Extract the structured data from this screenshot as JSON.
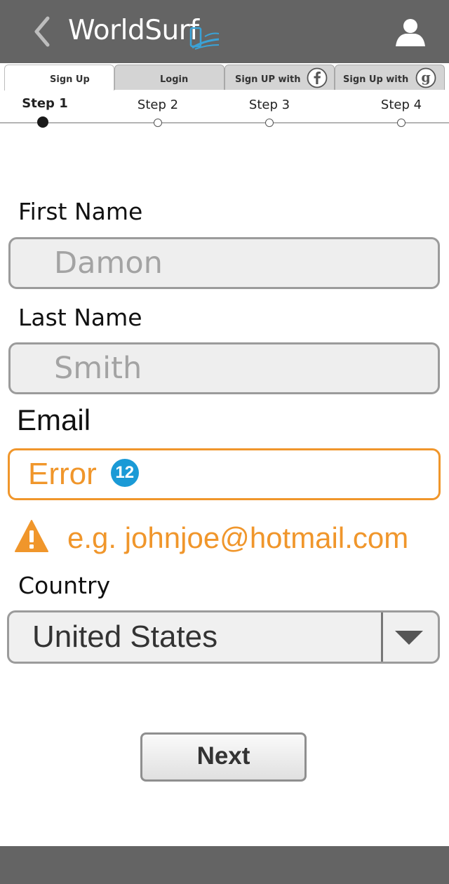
{
  "header": {
    "title": "WorldSurf",
    "back_icon": "chevron-left-icon",
    "logo_icon": "phone-wave-logo-icon",
    "user_icon": "user-icon",
    "background": "#646464"
  },
  "tabs": [
    {
      "label": "Sign Up",
      "active": true
    },
    {
      "label": "Login",
      "active": false
    },
    {
      "label": "Sign UP with",
      "icon": "facebook-icon",
      "active": false
    },
    {
      "label": "Sign Up with",
      "icon": "google-icon",
      "active": false
    }
  ],
  "steps": [
    {
      "label": "Step 1",
      "current": true
    },
    {
      "label": "Step 2",
      "current": false
    },
    {
      "label": "Step 3",
      "current": false
    },
    {
      "label": "Step 4",
      "current": false
    }
  ],
  "form": {
    "first_name": {
      "label": "First Name",
      "placeholder": "Damon"
    },
    "last_name": {
      "label": "Last Name",
      "placeholder": "Smith"
    },
    "email": {
      "label": "Email",
      "value": "Error",
      "badge": "12",
      "hint_icon": "warning-icon",
      "hint": "e.g. johnjoe@hotmail.com"
    },
    "country": {
      "label": "Country",
      "value": "United States",
      "icon": "dropdown-arrow-icon"
    },
    "next_label": "Next"
  },
  "colors": {
    "error": "#f0962b",
    "badge": "#1a9ad6",
    "header_bg": "#646464"
  }
}
